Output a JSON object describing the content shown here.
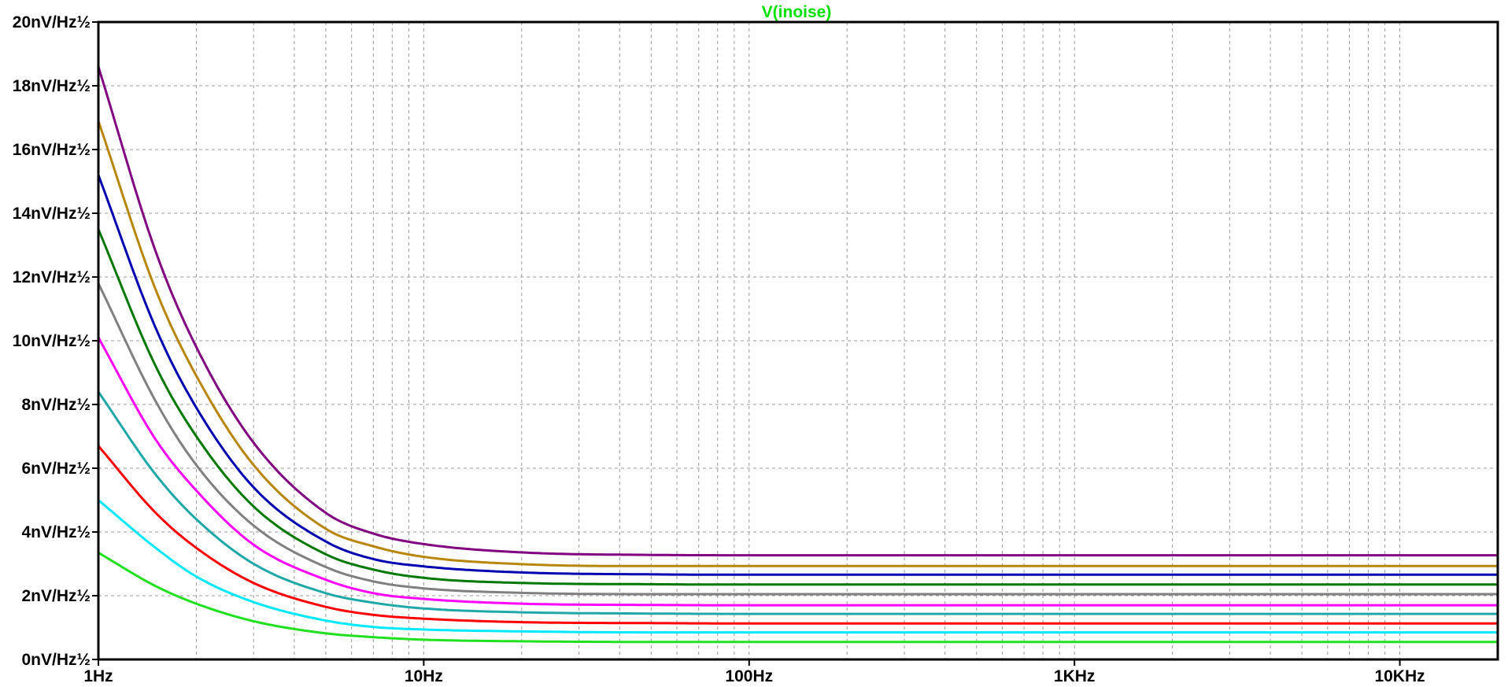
{
  "chart_data": {
    "type": "line",
    "title": "V(inoise)",
    "title_color": "#00e000",
    "x_scale": "log",
    "xlim": [
      1,
      20000
    ],
    "ylim": [
      0,
      20
    ],
    "grid": true,
    "x_tick_labels": [
      {
        "value": 1,
        "label": "1Hz"
      },
      {
        "value": 10,
        "label": "10Hz"
      },
      {
        "value": 100,
        "label": "100Hz"
      },
      {
        "value": 1000,
        "label": "1KHz"
      },
      {
        "value": 10000,
        "label": "10KHz"
      }
    ],
    "y_tick_labels": [
      {
        "value": 0,
        "label": "0nV/Hz½"
      },
      {
        "value": 2,
        "label": "2nV/Hz½"
      },
      {
        "value": 4,
        "label": "4nV/Hz½"
      },
      {
        "value": 6,
        "label": "6nV/Hz½"
      },
      {
        "value": 8,
        "label": "8nV/Hz½"
      },
      {
        "value": 10,
        "label": "10nV/Hz½"
      },
      {
        "value": 12,
        "label": "12nV/Hz½"
      },
      {
        "value": 14,
        "label": "14nV/Hz½"
      },
      {
        "value": 16,
        "label": "16nV/Hz½"
      },
      {
        "value": 18,
        "label": "18nV/Hz½"
      },
      {
        "value": 20,
        "label": "20nV/Hz½"
      }
    ],
    "x": [
      1,
      1.5,
      2,
      3,
      5,
      7,
      10,
      20,
      50,
      100,
      1000,
      10000,
      20000
    ],
    "series": [
      {
        "color": "#800080",
        "values": [
          18.6,
          12.8,
          9.8,
          6.8,
          4.6,
          3.95,
          3.62,
          3.36,
          3.28,
          3.27,
          3.27,
          3.27,
          3.27
        ]
      },
      {
        "color": "#b8860b",
        "values": [
          16.9,
          11.6,
          8.9,
          6.1,
          4.1,
          3.55,
          3.22,
          2.99,
          2.93,
          2.93,
          2.93,
          2.93,
          2.93
        ]
      },
      {
        "color": "#0000b0",
        "values": [
          15.2,
          10.4,
          7.9,
          5.4,
          3.7,
          3.15,
          2.92,
          2.73,
          2.67,
          2.66,
          2.66,
          2.66,
          2.66
        ]
      },
      {
        "color": "#007800",
        "values": [
          13.5,
          9.2,
          7.0,
          4.8,
          3.3,
          2.82,
          2.56,
          2.4,
          2.36,
          2.35,
          2.35,
          2.35,
          2.35
        ]
      },
      {
        "color": "#808080",
        "values": [
          11.8,
          8.1,
          6.1,
          4.2,
          2.9,
          2.45,
          2.23,
          2.09,
          2.05,
          2.05,
          2.05,
          2.05,
          2.05
        ]
      },
      {
        "color": "#ff00ff",
        "values": [
          10.1,
          6.9,
          5.3,
          3.6,
          2.5,
          2.08,
          1.9,
          1.75,
          1.71,
          1.7,
          1.7,
          1.7,
          1.7
        ]
      },
      {
        "color": "#20a8a8",
        "values": [
          8.4,
          5.8,
          4.4,
          3.0,
          2.08,
          1.78,
          1.6,
          1.48,
          1.44,
          1.43,
          1.43,
          1.43,
          1.43
        ]
      },
      {
        "color": "#ff0000",
        "values": [
          6.7,
          4.6,
          3.5,
          2.4,
          1.65,
          1.4,
          1.28,
          1.17,
          1.14,
          1.13,
          1.13,
          1.13,
          1.13
        ]
      },
      {
        "color": "#00e8ff",
        "values": [
          5.0,
          3.5,
          2.6,
          1.8,
          1.22,
          1.02,
          0.94,
          0.88,
          0.85,
          0.85,
          0.85,
          0.85,
          0.85
        ]
      },
      {
        "color": "#20e020",
        "values": [
          3.35,
          2.3,
          1.75,
          1.2,
          0.82,
          0.7,
          0.62,
          0.57,
          0.55,
          0.55,
          0.55,
          0.55,
          0.55
        ]
      }
    ]
  }
}
